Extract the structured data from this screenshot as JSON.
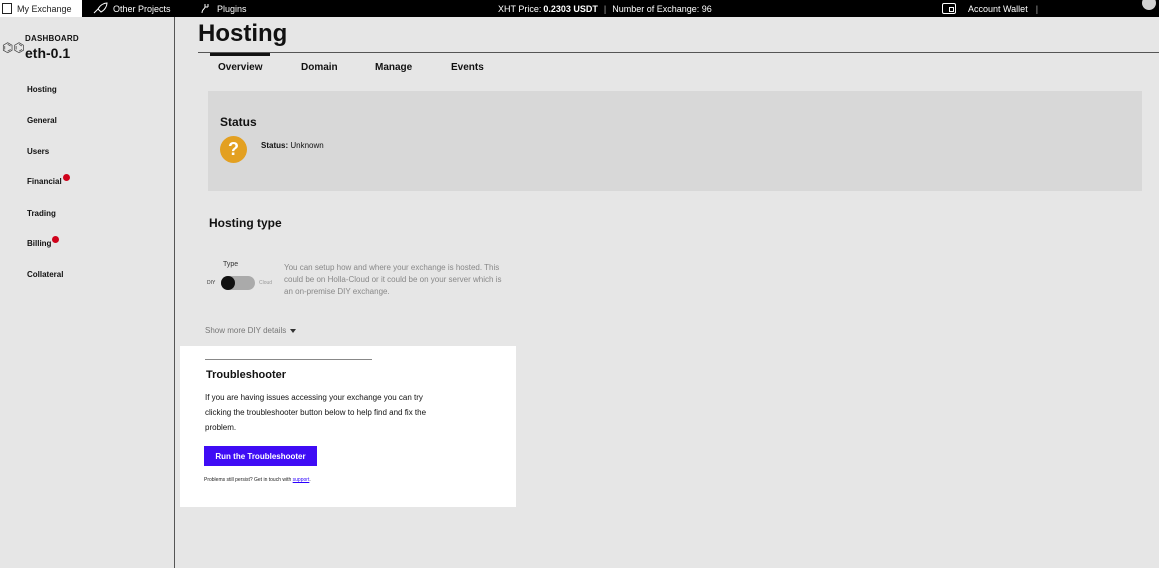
{
  "topbar": {
    "my_exchange": "My Exchange",
    "other_projects": "Other Projects",
    "plugins": "Plugins",
    "xht_price_label": "XHT Price:",
    "xht_price_value": "0.2303 USDT",
    "separator": "|",
    "exchange_count": "Number of Exchange: 96",
    "account_wallet": "Account Wallet",
    "wallet_separator": "|"
  },
  "sidebar": {
    "dashboard_label": "DASHBOARD",
    "exchange_name": "eth-0.1",
    "items": [
      {
        "label": "Hosting",
        "badge": false
      },
      {
        "label": "General",
        "badge": false
      },
      {
        "label": "Users",
        "badge": false
      },
      {
        "label": "Financial",
        "badge": true
      },
      {
        "label": "Trading",
        "badge": false
      },
      {
        "label": "Billing",
        "badge": true
      },
      {
        "label": "Collateral",
        "badge": false
      }
    ]
  },
  "page": {
    "title": "Hosting",
    "tabs": [
      "Overview",
      "Domain",
      "Manage",
      "Events"
    ],
    "active_tab": "Overview"
  },
  "status": {
    "heading": "Status",
    "icon": "question-icon",
    "label": "Status:",
    "value": "Unknown",
    "icon_color": "#e3a021"
  },
  "hosting_type": {
    "heading": "Hosting type",
    "type_label": "Type",
    "diy_label": "DIY",
    "cloud_label": "Cloud",
    "description": "You can setup how and where your exchange is hosted. This could be on Holla-Cloud or it could be on your server which is an on-premise DIY exchange.",
    "show_more": "Show more DIY details"
  },
  "troubleshooter": {
    "title": "Troubleshooter",
    "description": "If you are having issues accessing your exchange you can try clicking the troubleshooter button below to help find and fix the problem.",
    "button_label": "Run the Troubleshooter",
    "footer_text": "Problems still persist? Get in touch with",
    "support_link": "support",
    "footer_end": ".",
    "button_color": "#3f0cf5"
  }
}
